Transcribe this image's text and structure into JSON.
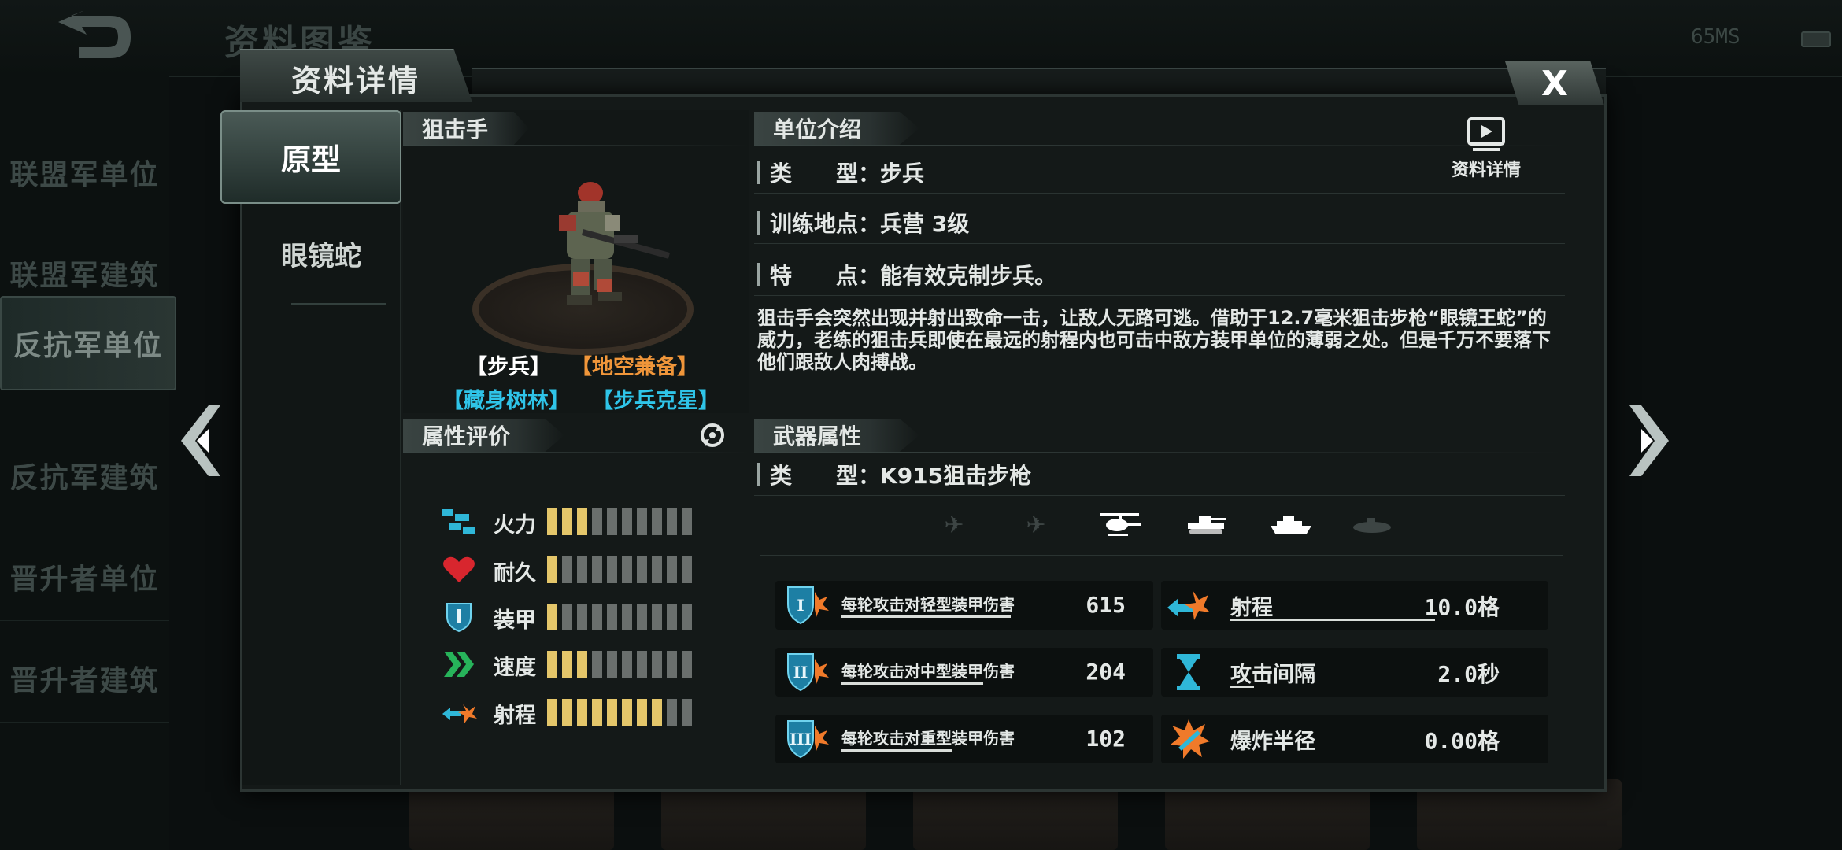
{
  "topbar": {
    "title": "资料图鉴",
    "signal": "65MS"
  },
  "nav": {
    "items": [
      "联盟军单位",
      "联盟军建筑",
      "反抗军单位",
      "反抗军建筑",
      "晋升者单位",
      "晋升者建筑"
    ],
    "active_index": 2
  },
  "panel": {
    "header": "资料详情",
    "close": "X"
  },
  "variants": {
    "prototype": "原型",
    "cobra": "眼镜蛇"
  },
  "unit": {
    "name": "狙击手",
    "tags": [
      "【步兵】",
      "【地空兼备】",
      "【藏身树林】",
      "【步兵克星】"
    ]
  },
  "attributes": {
    "title": "属性评价",
    "rows": [
      {
        "label": "火力",
        "icon": "firepower-icon",
        "level": 3
      },
      {
        "label": "耐久",
        "icon": "heart-icon",
        "level": 1
      },
      {
        "label": "装甲",
        "icon": "armor-shield-icon",
        "level": 1
      },
      {
        "label": "速度",
        "icon": "speed-chevron-icon",
        "level": 3
      },
      {
        "label": "射程",
        "icon": "range-icon",
        "level": 8
      }
    ],
    "max": 10
  },
  "intro": {
    "title": "单位介绍",
    "type": "类　　型：步兵",
    "training": "训练地点：兵营 3级",
    "feature": "特　　点：能有效克制步兵。",
    "description": "狙击手会突然出现并射出致命一击，让敌人无路可逃。借助于12.7毫米狙击步枪“眼镜王蛇”的威力，老练的狙击兵即使在最远的射程内也可击中敌方装甲单位的薄弱之处。但是千万不要落下他们跟敌人肉搏战。",
    "video_label": "资料详情"
  },
  "weapon": {
    "title": "武器属性",
    "type": "类　　型：K915狙击步枪",
    "targets": [
      {
        "icon": "jet-icon",
        "enabled": false
      },
      {
        "icon": "plane-icon",
        "enabled": false
      },
      {
        "icon": "helicopter-icon",
        "enabled": true
      },
      {
        "icon": "tank-icon",
        "enabled": true
      },
      {
        "icon": "ship-icon",
        "enabled": true
      },
      {
        "icon": "submarine-icon",
        "enabled": false
      }
    ],
    "stats_left": [
      {
        "label": "每轮攻击对轻型装甲伤害",
        "value": "615",
        "roman": "I"
      },
      {
        "label": "每轮攻击对中型装甲伤害",
        "value": "204",
        "roman": "II"
      },
      {
        "label": "每轮攻击对重型装甲伤害",
        "value": "102",
        "roman": "III"
      }
    ],
    "stats_right": [
      {
        "label": "射程",
        "value": "10.0格"
      },
      {
        "label": "攻击间隔",
        "value": "2.0秒"
      },
      {
        "label": "爆炸半径",
        "value": "0.00格"
      }
    ]
  },
  "colors": {
    "tag_white": "#ffffff",
    "tag_orange": "#f0963a",
    "tag_cyan": "#2fc4e8",
    "bar_on": "#e4c66a",
    "bar_off": "#6a6f6d"
  }
}
